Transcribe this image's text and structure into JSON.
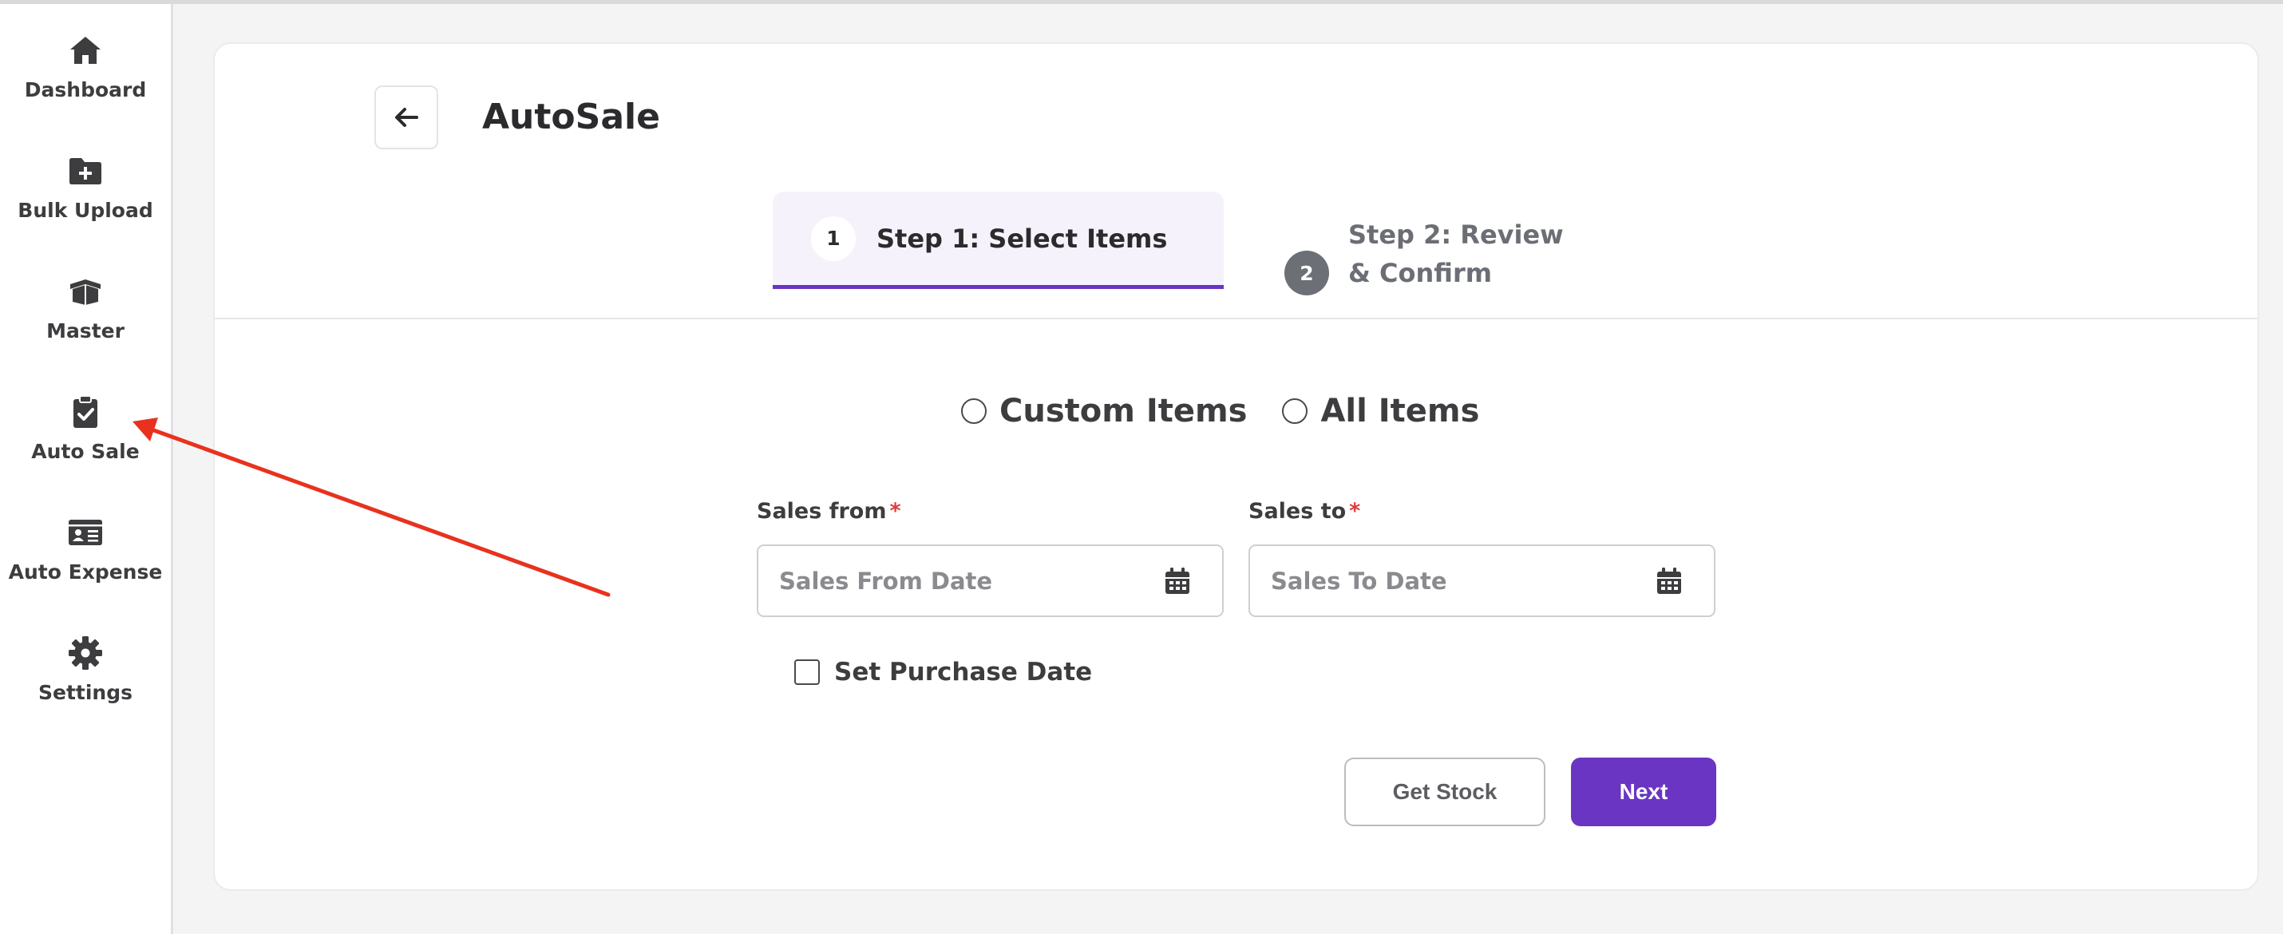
{
  "sidebar": {
    "items": [
      {
        "label": "Dashboard",
        "icon": "home-icon"
      },
      {
        "label": "Bulk Upload",
        "icon": "folder-plus-icon"
      },
      {
        "label": "Master",
        "icon": "open-box-icon"
      },
      {
        "label": "Auto Sale",
        "icon": "clipboard-check-icon"
      },
      {
        "label": "Auto Expense",
        "icon": "id-card-icon"
      },
      {
        "label": "Settings",
        "icon": "gear-icon"
      }
    ]
  },
  "header": {
    "title": "AutoSale",
    "back_icon": "arrow-left-icon"
  },
  "steps": [
    {
      "number": "1",
      "label": "Step 1: Select Items",
      "active": true
    },
    {
      "number": "2",
      "label": "Step 2: Review & Confirm",
      "active": false
    }
  ],
  "item_selection": {
    "options": [
      {
        "label": "Custom Items",
        "selected": false
      },
      {
        "label": "All Items",
        "selected": false
      }
    ]
  },
  "form": {
    "sales_from": {
      "label": "Sales from",
      "required_mark": "*",
      "placeholder": "Sales From Date",
      "value": ""
    },
    "sales_to": {
      "label": "Sales to",
      "required_mark": "*",
      "placeholder": "Sales To Date",
      "value": ""
    },
    "set_purchase_date": {
      "label": "Set Purchase Date",
      "checked": false
    }
  },
  "actions": {
    "get_stock": "Get Stock",
    "next": "Next"
  },
  "colors": {
    "accent": "#6a35c2",
    "annotation_arrow": "#e8321e",
    "required": "#e23a3a"
  }
}
